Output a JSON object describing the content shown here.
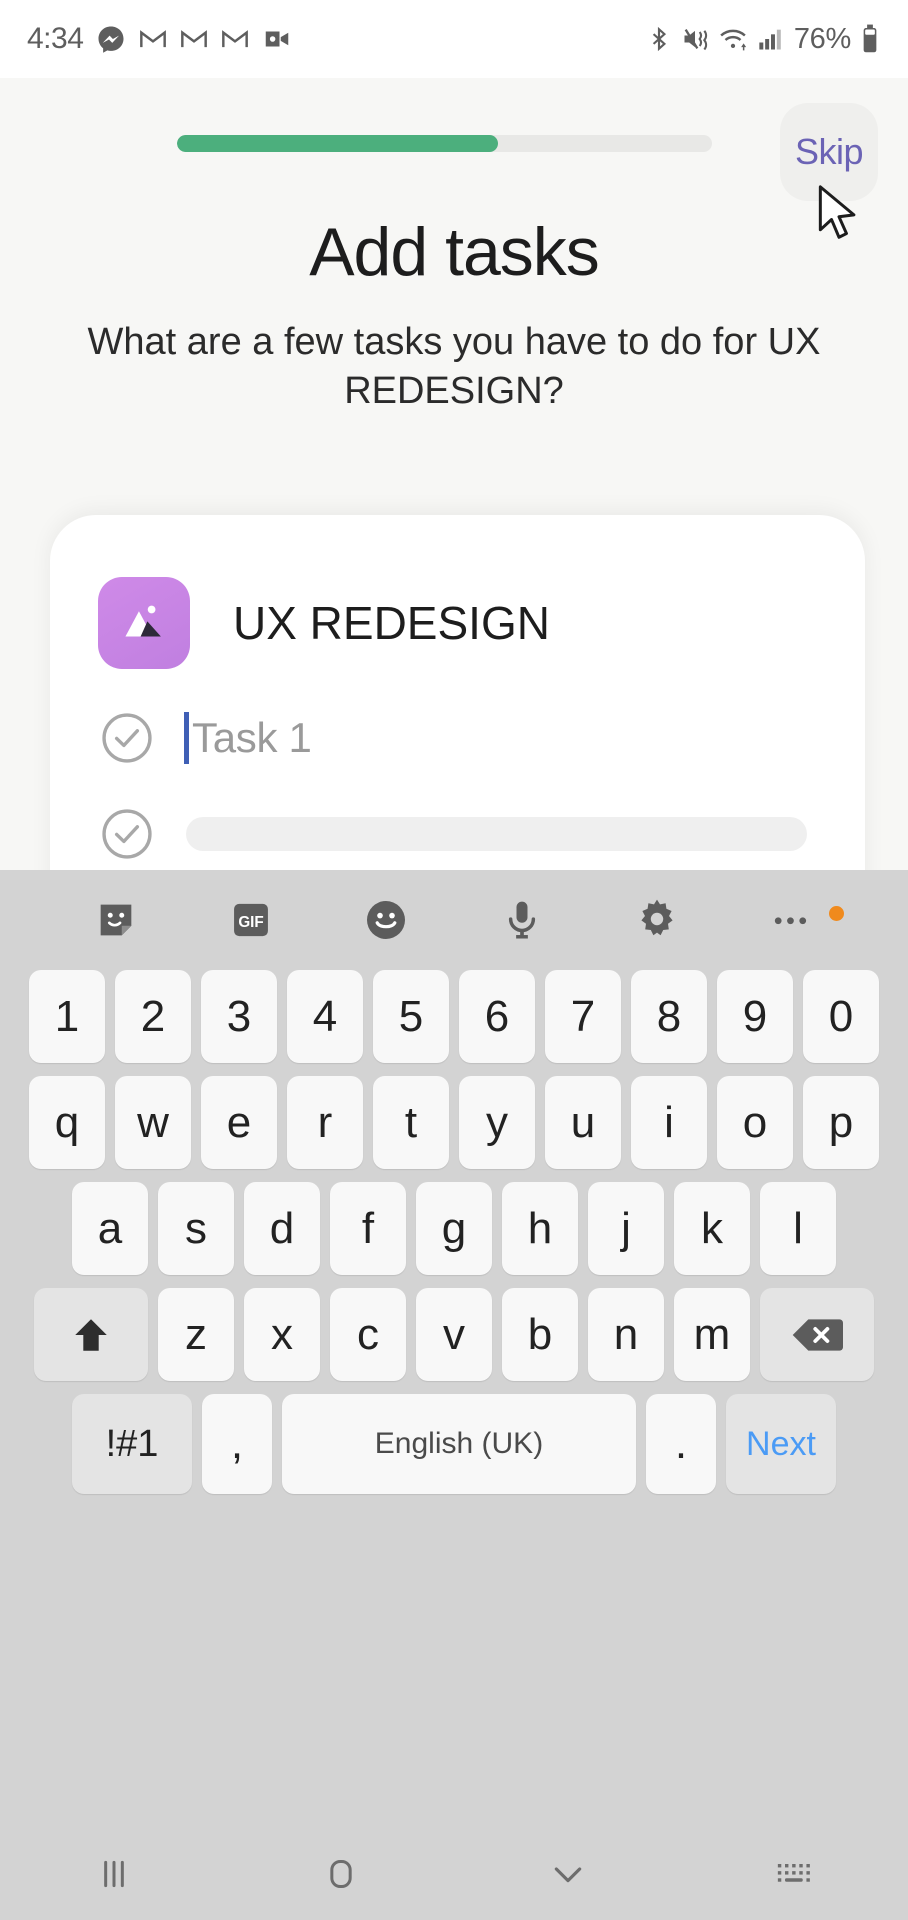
{
  "status_bar": {
    "time": "4:34",
    "battery_percent": "76%",
    "left_icons": [
      "messenger-icon",
      "gmail-icon",
      "gmail-icon",
      "gmail-icon",
      "video-camera-icon"
    ],
    "right_icons": [
      "bluetooth-icon",
      "mute-vibrate-icon",
      "wifi-icon",
      "cellular-signal-icon",
      "battery-icon"
    ]
  },
  "onboarding": {
    "progress_percent": 60,
    "progress_color": "#4caf7d",
    "skip_label": "Skip",
    "skip_color": "#6b63b5",
    "title": "Add tasks",
    "subtitle": "What are a few tasks you have to do for UX REDESIGN?"
  },
  "task_card": {
    "project_name": "UX REDESIGN",
    "project_icon": "mountain-icon",
    "project_icon_color": "#c884e4",
    "rows": [
      {
        "placeholder": "Task 1",
        "focused": true,
        "skeleton": false
      },
      {
        "placeholder": "",
        "focused": false,
        "skeleton": true
      },
      {
        "placeholder": "",
        "focused": false,
        "skeleton": true
      }
    ]
  },
  "keyboard": {
    "toolbar": [
      {
        "name": "sticker-icon"
      },
      {
        "name": "gif-icon",
        "label": "GIF"
      },
      {
        "name": "emoji-icon"
      },
      {
        "name": "microphone-icon"
      },
      {
        "name": "gear-icon"
      },
      {
        "name": "more-options-icon",
        "badge": true
      }
    ],
    "row_numbers": [
      "1",
      "2",
      "3",
      "4",
      "5",
      "6",
      "7",
      "8",
      "9",
      "0"
    ],
    "row_top": [
      "q",
      "w",
      "e",
      "r",
      "t",
      "y",
      "u",
      "i",
      "o",
      "p"
    ],
    "row_home": [
      "a",
      "s",
      "d",
      "f",
      "g",
      "h",
      "j",
      "k",
      "l"
    ],
    "row_bottom": [
      "z",
      "x",
      "c",
      "v",
      "b",
      "n",
      "m"
    ],
    "shift_icon": "shift-up-arrow-icon",
    "backspace_icon": "backspace-icon",
    "symbols_label": "!#1",
    "comma_label": ",",
    "space_label": "English (UK)",
    "period_label": ".",
    "next_label": "Next",
    "next_color": "#4b9bf5"
  },
  "nav_bar": {
    "items": [
      {
        "name": "recents-icon"
      },
      {
        "name": "home-icon"
      },
      {
        "name": "hide-keyboard-chevron-icon"
      },
      {
        "name": "switch-keyboard-icon"
      }
    ]
  }
}
